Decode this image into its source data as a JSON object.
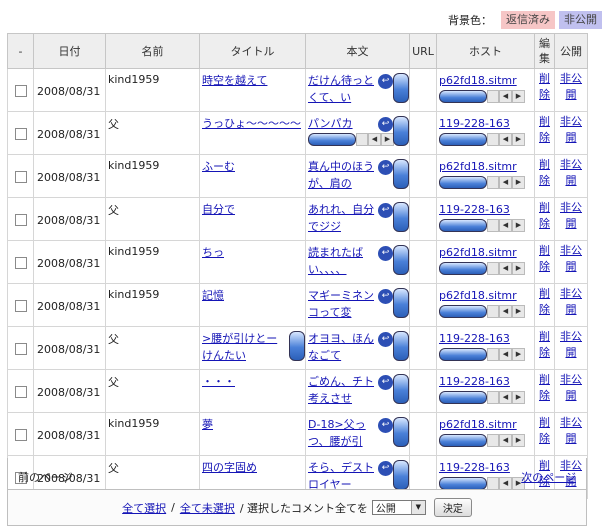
{
  "legend": {
    "label": "背景色：",
    "replied": "返信済み",
    "private": "非公開",
    "replied_color": "#f6c6c6",
    "private_color": "#c0c0ef"
  },
  "columns": {
    "select": "-",
    "date": "日付",
    "name": "名前",
    "title": "タイトル",
    "body": "本文",
    "url": "URL",
    "host": "ホスト",
    "edit": "編集",
    "public": "公開"
  },
  "rows": [
    {
      "date": "2008/08/31",
      "name": "kind1959",
      "title": "時空を越えて",
      "body": "だけん待っとくて、い",
      "host": "p62fd18.sitmr",
      "delete": "削除",
      "visibility": "非公開"
    },
    {
      "date": "2008/08/31",
      "name": "父",
      "title": "うっひょ〜〜〜〜〜",
      "body": "パンパカ",
      "host": "119-228-163",
      "delete": "削除",
      "visibility": "非公開"
    },
    {
      "date": "2008/08/31",
      "name": "kind1959",
      "title": "ふーむ",
      "body": "真ん中のほうが、肩の",
      "host": "p62fd18.sitmr",
      "delete": "削除",
      "visibility": "非公開"
    },
    {
      "date": "2008/08/31",
      "name": "父",
      "title": "自分で",
      "body": "あれれ、自分でジジ",
      "host": "119-228-163",
      "delete": "削除",
      "visibility": "非公開"
    },
    {
      "date": "2008/08/31",
      "name": "kind1959",
      "title": "ちっ",
      "body": "読まれたばい、、、、",
      "host": "p62fd18.sitmr",
      "delete": "削除",
      "visibility": "非公開"
    },
    {
      "date": "2008/08/31",
      "name": "kind1959",
      "title": "記憶",
      "body": "マギーミネンコって変",
      "host": "p62fd18.sitmr",
      "delete": "削除",
      "visibility": "非公開"
    },
    {
      "date": "2008/08/31",
      "name": "父",
      "title": ">腰が引けとーけんたい",
      "body": "オヨヨ、ほんなごて",
      "host": "119-228-163",
      "delete": "削除",
      "visibility": "非公開"
    },
    {
      "date": "2008/08/31",
      "name": "父",
      "title": "・・・",
      "body": "ごめん、チト考えさせ",
      "host": "119-228-163",
      "delete": "削除",
      "visibility": "非公開"
    },
    {
      "date": "2008/08/31",
      "name": "kind1959",
      "title": "夢",
      "body": "D-18>父っつ、腰が引",
      "host": "p62fd18.sitmr",
      "delete": "削除",
      "visibility": "非公開"
    },
    {
      "date": "2008/08/31",
      "name": "父",
      "title": "四の字固め",
      "body": "そら、デストロイヤー",
      "host": "119-228-163",
      "delete": "削除",
      "visibility": "非公開"
    }
  ],
  "pager": {
    "prev": "前のページ",
    "next": "次のページ"
  },
  "bulk": {
    "select_all": "全て選択",
    "deselect_all": "全て未選択",
    "sep": "/",
    "label": "/ 選択したコメント全てを",
    "option": "公開",
    "submit": "決定"
  }
}
